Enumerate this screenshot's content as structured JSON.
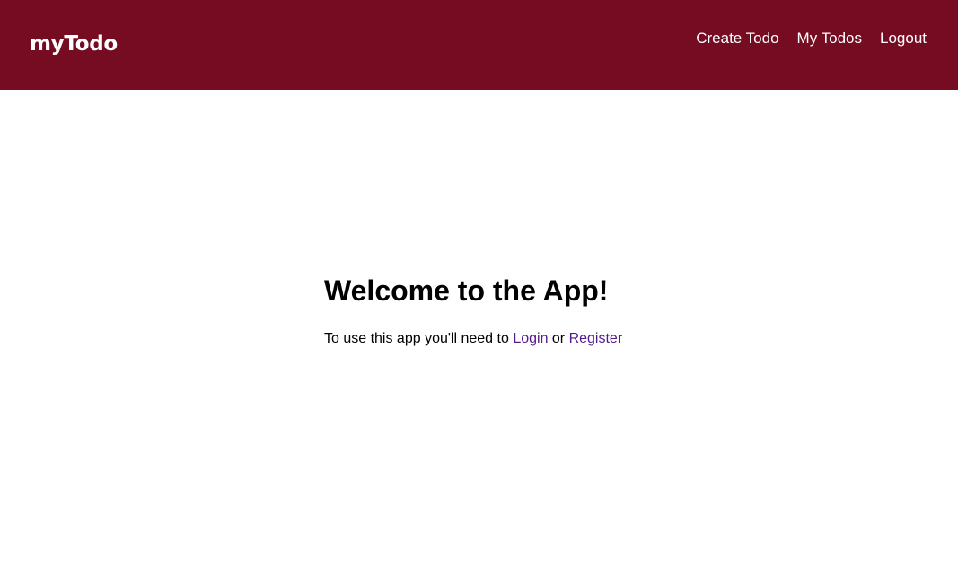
{
  "header": {
    "logo": "myTodo",
    "nav": {
      "create_todo": "Create Todo",
      "my_todos": "My Todos",
      "logout": "Logout"
    }
  },
  "main": {
    "heading": "Welcome to the App!",
    "message": {
      "prefix": "To use this app you'll need to ",
      "login_link": "Login ",
      "middle": "or ",
      "register_link": "Register"
    }
  },
  "colors": {
    "header_bg": "#760c22",
    "header_text": "#ffffff",
    "link_visited": "#551a8b"
  }
}
